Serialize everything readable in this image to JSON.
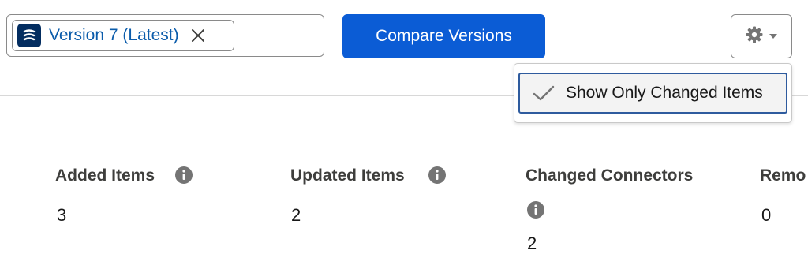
{
  "version_picker": {
    "selected_label": "Version 7 (Latest)",
    "icon": "flow-icon"
  },
  "toolbar": {
    "compare_label": "Compare Versions",
    "settings_icon": "gear-icon"
  },
  "settings_menu": {
    "items": [
      {
        "label": "Show Only Changed Items",
        "checked": true
      }
    ]
  },
  "summary": {
    "added": {
      "label": "Added Items",
      "value": "3"
    },
    "updated": {
      "label": "Updated Items",
      "value": "2"
    },
    "connectors": {
      "label": "Changed Connectors",
      "value": "2"
    },
    "removed": {
      "label": "Remo",
      "value": "0"
    }
  },
  "colors": {
    "brand_blue": "#0b5cd5",
    "link_blue": "#0b5cab",
    "focus_border": "#2e5b9e"
  }
}
